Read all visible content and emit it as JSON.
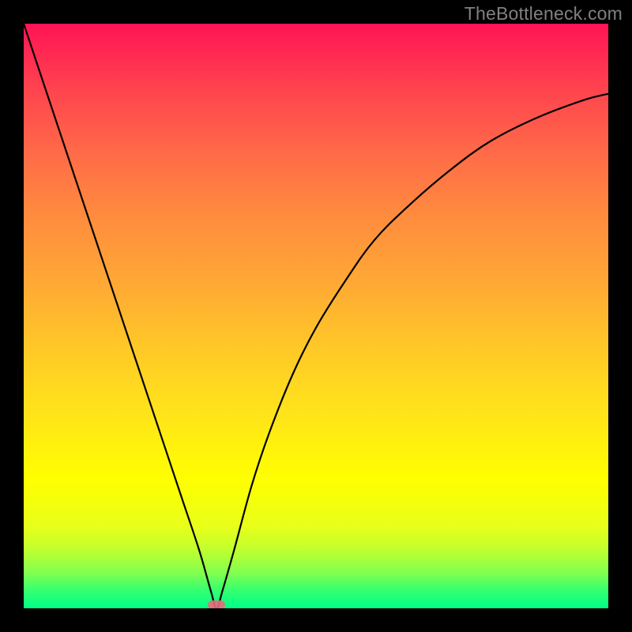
{
  "watermark": {
    "text": "TheBottleneck.com"
  },
  "colors": {
    "background": "#000000",
    "gradient": [
      "#ff1355",
      "#ff6a48",
      "#ffaa34",
      "#ffe21b",
      "#ffff00",
      "#80ff50",
      "#00ff88"
    ],
    "curve_stroke": "#000000",
    "marker_fill": "#e96a7a"
  },
  "chart_data": {
    "type": "line",
    "title": "",
    "xlabel": "",
    "ylabel": "",
    "xlim": [
      0,
      100
    ],
    "ylim": [
      0,
      100
    ],
    "grid": false,
    "legend": null,
    "series": [
      {
        "name": "bottleneck-curve",
        "x": [
          0,
          3,
          6,
          9,
          12,
          15,
          18,
          21,
          24,
          27,
          30,
          32,
          33,
          34,
          36,
          39,
          42,
          46,
          50,
          55,
          60,
          66,
          73,
          80,
          88,
          96,
          100
        ],
        "y": [
          100,
          91,
          82,
          73,
          64,
          55,
          46,
          37,
          28,
          19,
          10,
          3,
          0,
          3,
          10,
          21,
          30,
          40,
          48,
          56,
          63,
          69,
          75,
          80,
          84,
          87,
          88
        ]
      }
    ],
    "markers": [
      {
        "name": "optimal-point",
        "x": 33,
        "y": 0
      }
    ]
  }
}
